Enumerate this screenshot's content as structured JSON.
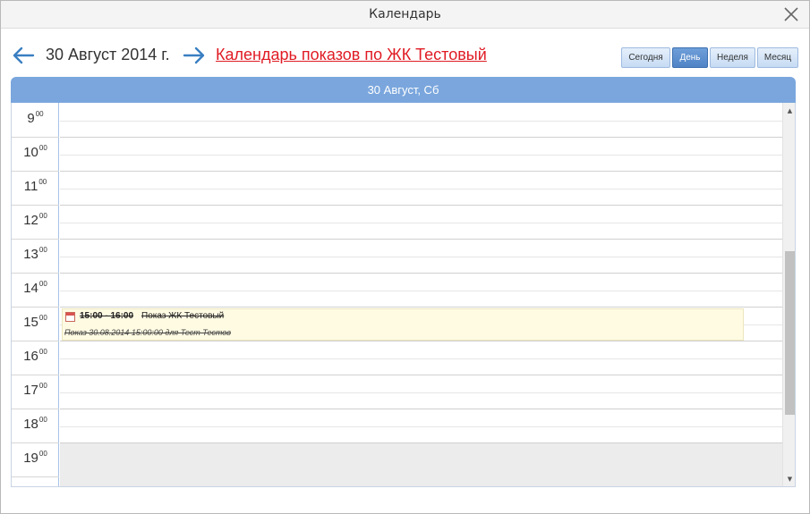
{
  "window": {
    "title": "Календарь"
  },
  "toolbar": {
    "date_label": "30 Август 2014 г.",
    "calendar_link": "Календарь показов по ЖК Тестовый",
    "views": [
      {
        "label": "Сегодня",
        "active": false
      },
      {
        "label": "День",
        "active": true
      },
      {
        "label": "Неделя",
        "active": false
      },
      {
        "label": "Месяц",
        "active": false
      }
    ]
  },
  "day_header": "30 Август, Сб",
  "hours": [
    "9",
    "10",
    "11",
    "12",
    "13",
    "14",
    "15",
    "16",
    "17",
    "18",
    "19"
  ],
  "minutes_suffix": "00",
  "event": {
    "time": "15:00 - 16:00",
    "title": "Показ ЖК Тестовый",
    "description": "Показ 30.08.2014 15:00:00 для Тест Тестов"
  },
  "icons": {
    "close": "close-icon",
    "prev": "arrow-left-icon",
    "next": "arrow-right-icon",
    "event": "calendar-event-icon"
  },
  "colors": {
    "accent": "#7aa6dd",
    "link": "#e01b24",
    "event_bg": "#fffbe3",
    "active_view": "#4f83c6"
  }
}
